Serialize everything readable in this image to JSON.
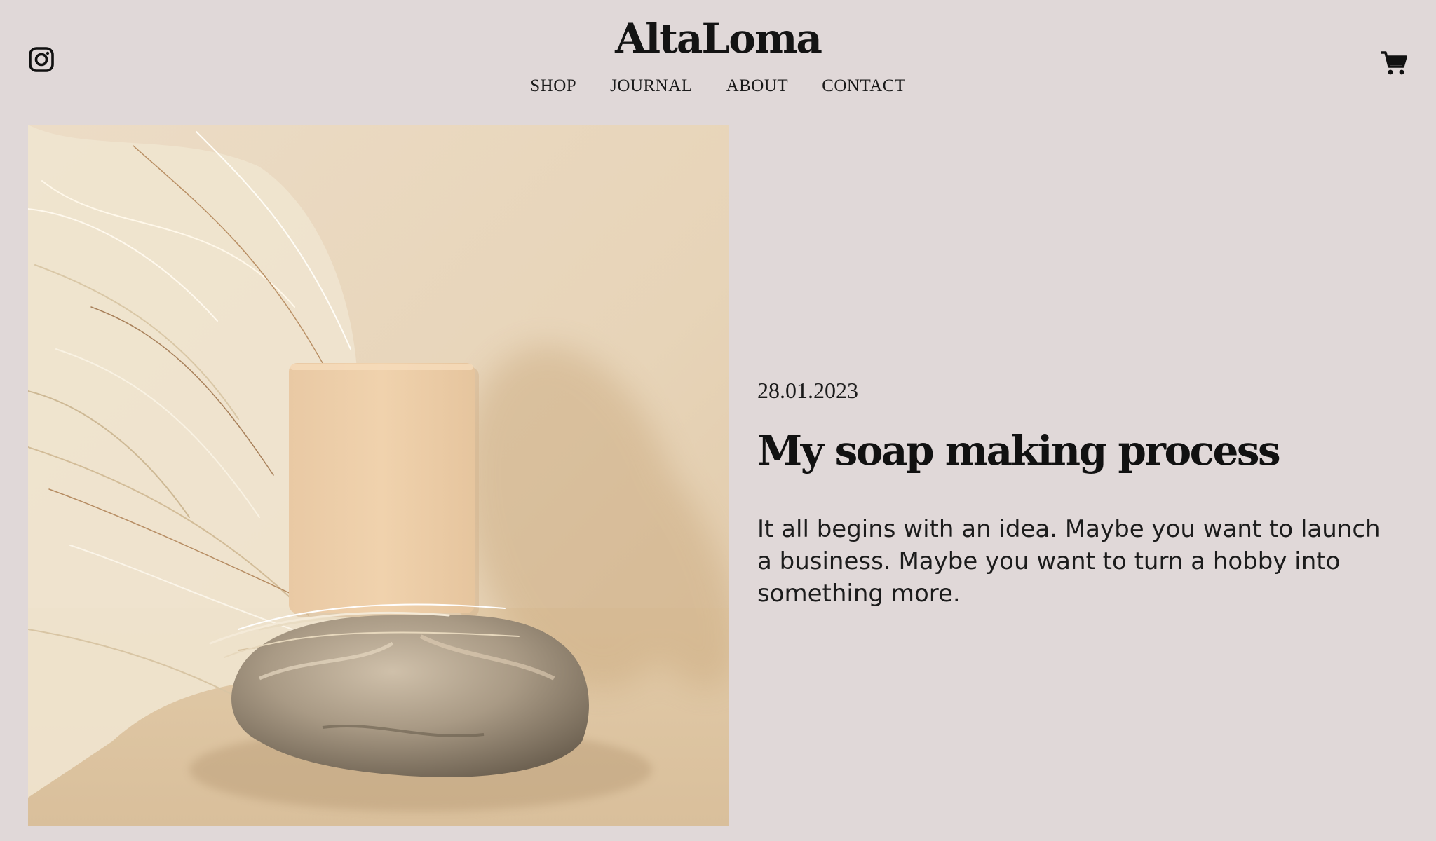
{
  "brand": {
    "name": "AltaLoma"
  },
  "nav": {
    "items": [
      {
        "label": "SHOP"
      },
      {
        "label": "JOURNAL"
      },
      {
        "label": "ABOUT"
      },
      {
        "label": "CONTACT"
      }
    ]
  },
  "icons": {
    "social": "instagram-icon",
    "cart": "cart-icon"
  },
  "post": {
    "date": "28.01.2023",
    "title": "My soap making process",
    "excerpt": "It all begins with an idea. Maybe you want to launch a business. Maybe you want to turn a hobby into something more."
  },
  "colors": {
    "background": "#e0d8d8",
    "text": "#111111",
    "image_backdrop": "#ead9c2"
  }
}
